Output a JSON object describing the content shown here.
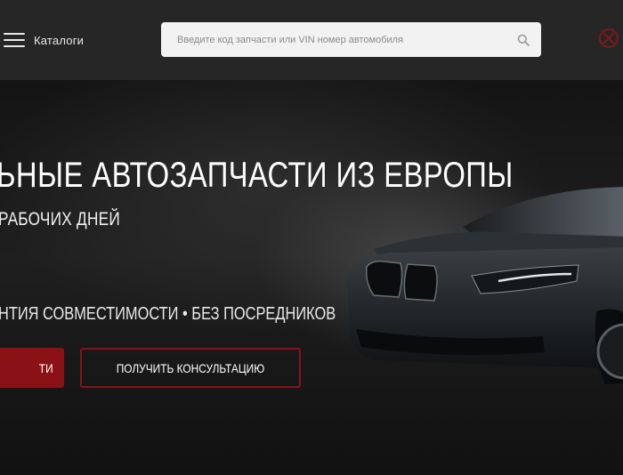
{
  "header": {
    "menu_label": "Каталоги",
    "search": {
      "placeholder": "Введите код запчасти или VIN номер автомобиля",
      "value": ""
    }
  },
  "hero": {
    "title": "ЬНЫЕ АВТОЗАПЧАСТИ ИЗ ЕВРОПЫ",
    "subtitle": "РАБОЧИХ ДНЕЙ",
    "features": "НТИЯ СОВМЕСТИМОСТИ • БЕЗ ПОСРЕДНИКОВ",
    "primary_button": "ТИ",
    "secondary_button": "ПОЛУЧИТЬ КОНСУЛЬТАЦИЮ"
  },
  "colors": {
    "accent": "#8a1216",
    "header_bg": "#262626",
    "search_bg": "#f2f2f2"
  },
  "icons": [
    "menu-icon",
    "search-icon",
    "brand-mark-icon"
  ]
}
